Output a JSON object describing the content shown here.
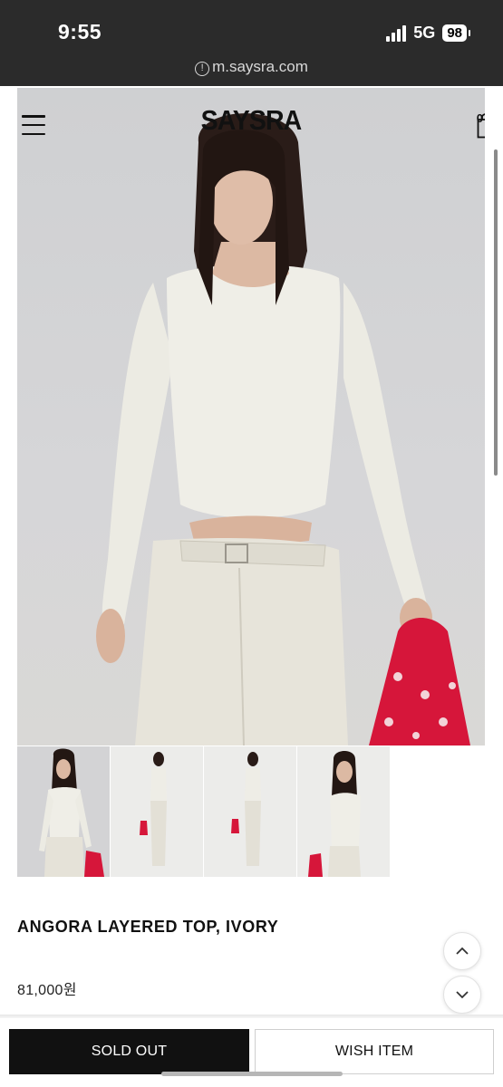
{
  "status_bar": {
    "time": "9:55",
    "network": "5G",
    "battery": "98"
  },
  "browser": {
    "url": "m.saysra.com"
  },
  "header": {
    "logo": "SAYSRA",
    "cart_count": "0"
  },
  "icons": {
    "menu": "hamburger-menu-icon",
    "cart": "shopping-bag-icon",
    "up": "chevron-up-icon",
    "down": "chevron-down-icon",
    "info": "info-icon"
  },
  "product": {
    "name": "ANGORA LAYERED TOP, IVORY",
    "price": "81,000원"
  },
  "actions": {
    "sold_out": "SOLD OUT",
    "wish": "WISH ITEM"
  },
  "colors": {
    "dark_bar": "#2b2b2b",
    "button_dark": "#111111",
    "bag_red": "#d6163a"
  }
}
